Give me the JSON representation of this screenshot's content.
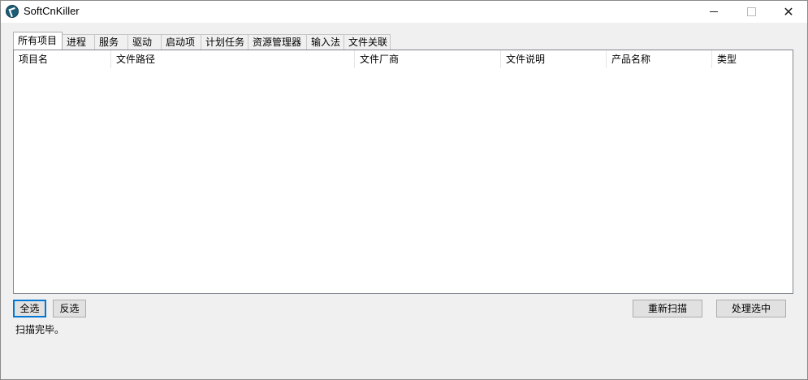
{
  "window": {
    "title": "SoftCnKiller"
  },
  "tabs": [
    {
      "label": "所有项目",
      "active": true
    },
    {
      "label": "进程"
    },
    {
      "label": "服务"
    },
    {
      "label": "驱动"
    },
    {
      "label": "启动项"
    },
    {
      "label": "计划任务"
    },
    {
      "label": "资源管理器"
    },
    {
      "label": "输入法"
    },
    {
      "label": "文件关联"
    }
  ],
  "list": {
    "columns": [
      "项目名",
      "文件路径",
      "文件厂商",
      "文件说明",
      "产品名称",
      "类型"
    ],
    "rows": []
  },
  "buttons": {
    "select_all": "全选",
    "invert": "反选",
    "rescan": "重新扫描",
    "process": "处理选中"
  },
  "status_text": "扫描完毕。"
}
